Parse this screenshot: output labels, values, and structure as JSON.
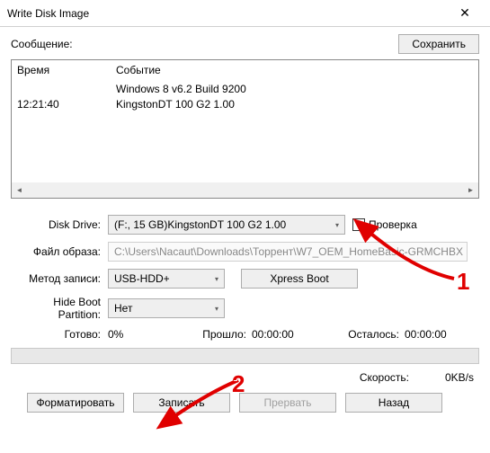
{
  "window": {
    "title": "Write Disk Image"
  },
  "top": {
    "message_label": "Сообщение:",
    "save_button": "Сохранить"
  },
  "log": {
    "header_time": "Время",
    "header_event": "Событие",
    "rows": [
      {
        "time": "",
        "event": "Windows 8 v6.2 Build 9200"
      },
      {
        "time": "12:21:40",
        "event": "KingstonDT 100 G2       1.00"
      }
    ]
  },
  "form": {
    "disk_drive_label": "Disk Drive:",
    "disk_drive_value": "(F:, 15 GB)KingstonDT 100 G2      1.00",
    "check_label": "Проверка",
    "image_file_label": "Файл образа:",
    "image_file_value": "C:\\Users\\Nacaut\\Downloads\\Торрент\\W7_OEM_HomeBasic-GRMCHBX",
    "write_method_label": "Метод записи:",
    "write_method_value": "USB-HDD+",
    "xpress_boot": "Xpress Boot",
    "hide_boot_label": "Hide Boot Partition:",
    "hide_boot_value": "Нет"
  },
  "status": {
    "ready_label": "Готово:",
    "percent": "0%",
    "elapsed_label": "Прошло:",
    "elapsed": "00:00:00",
    "remain_label": "Осталось:",
    "remain": "00:00:00",
    "speed_label": "Скорость:",
    "speed": "0KB/s"
  },
  "buttons": {
    "format": "Форматировать",
    "write": "Записать",
    "abort": "Прервать",
    "back": "Назад"
  },
  "annotations": {
    "one": "1",
    "two": "2"
  }
}
